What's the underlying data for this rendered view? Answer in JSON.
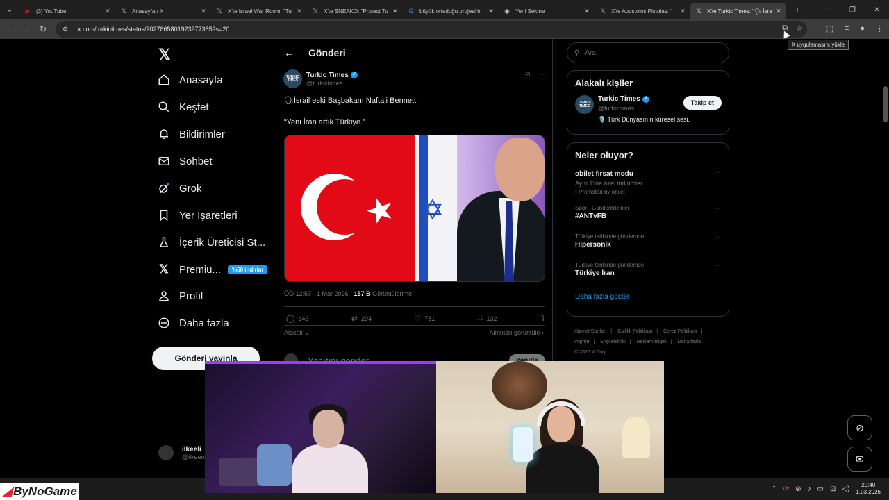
{
  "browser": {
    "tabs": [
      {
        "title": "(3) YouTube",
        "icon": "youtube-icon",
        "active": false
      },
      {
        "title": "Anasayfa / X",
        "icon": "x-icon",
        "active": false
      },
      {
        "title": "X'te Israel War Room: \"Tu",
        "icon": "x-icon",
        "active": false
      },
      {
        "title": "X'te SNEAKO: \"Protect Tu",
        "icon": "x-icon",
        "active": false
      },
      {
        "title": "büyük ortadoğu projesi h",
        "icon": "google-icon",
        "active": false
      },
      {
        "title": "Yeni Sekme",
        "icon": "chrome-icon",
        "active": false
      },
      {
        "title": "X'te Apostolos Pistolas: \"",
        "icon": "x-icon",
        "active": false
      },
      {
        "title": "X'te Turkic Times: \"🗣 İsra",
        "icon": "x-icon",
        "active": true
      }
    ],
    "url": "x.com/turkictimes/status/2027865801923977385?s=20",
    "tooltip": "X uygulamasını yükle"
  },
  "nav": {
    "items": [
      {
        "label": "Anasayfa",
        "icon": "home-icon"
      },
      {
        "label": "Keşfet",
        "icon": "search-icon"
      },
      {
        "label": "Bildirimler",
        "icon": "bell-icon"
      },
      {
        "label": "Sohbet",
        "icon": "mail-icon"
      },
      {
        "label": "Grok",
        "icon": "grok-icon"
      },
      {
        "label": "Yer İşaretleri",
        "icon": "bookmark-icon"
      },
      {
        "label": "İçerik Üreticisi St...",
        "icon": "flask-icon"
      },
      {
        "label": "Premiu...",
        "icon": "x-premium-icon"
      },
      {
        "label": "Profil",
        "icon": "profile-icon"
      },
      {
        "label": "Daha fazla",
        "icon": "more-circle-icon"
      }
    ],
    "premium_badge": "%50 indirim",
    "post_button": "Gönderi yayınla",
    "user": {
      "name": "ilkeeli",
      "handle": "@ilkeeo"
    }
  },
  "post": {
    "header": "Gönderi",
    "author_name": "Turkic Times",
    "author_handle": "@turkictimes",
    "avatar_text": "TURKIC TIMES",
    "text_line1": "🗣İsrail eski Başbakanı Naftali Bennett:",
    "text_line2": "“Yeni İran artık Türkiye.”",
    "time": "ÖÖ 12:57 · 1 Mar 2026 · ",
    "views_value": "157 B",
    "views_label": " Görüntülenme",
    "replies": "346",
    "reposts": "294",
    "likes": "781",
    "bookmarks": "132",
    "relevant_toggle": "Alakalı",
    "quotes_link": "Alıntıları görüntüle",
    "reply_placeholder": "Yanıtını gönder",
    "reply_button": "Yanıtla"
  },
  "sidebar": {
    "search_placeholder": "Ara",
    "relevant_people_title": "Alakalı kişiler",
    "person": {
      "name": "Turkic Times",
      "handle": "@turkictimes",
      "bio": "🎙️ Türk Dünyasının küresel sesi.",
      "follow": "Takip et"
    },
    "whats_happening_title": "Neler oluyor?",
    "trends": [
      {
        "context": "",
        "title": "obilet fırsat modu",
        "subtitle": "Ayın 1'ine özel indirimler",
        "promo": "Promoted by obilet"
      },
      {
        "context": "Spor · Gündemdekiler",
        "title": "#ANTvFB",
        "subtitle": "",
        "promo": ""
      },
      {
        "context": "Türkiye tarihinde gündemde",
        "title": "Hipersonik",
        "subtitle": "",
        "promo": ""
      },
      {
        "context": "Türkiye tarihinde gündemde",
        "title": "Türkiye İran",
        "subtitle": "",
        "promo": ""
      }
    ],
    "show_more": "Daha fazla göster",
    "footer": [
      "Hizmet Şartları",
      "|",
      "Gizlilik Politikası",
      "|",
      "Çerez Politikası",
      "|",
      "Imprint",
      "|",
      "Erişilebilirlik",
      "|",
      "Reklam bilgisi",
      "|",
      "Daha fazla ···",
      "© 2026 X Corp."
    ]
  },
  "overlay": {
    "brand": "ByNoGame"
  },
  "taskbar": {
    "time": "20:40",
    "date": "1.03.2026"
  },
  "colors": {
    "accent": "#1d9bf0",
    "background": "#000000",
    "border": "#2f3336"
  }
}
